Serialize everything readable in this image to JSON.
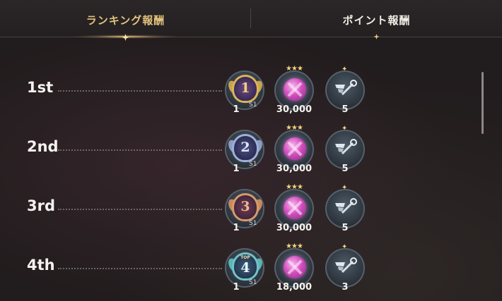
{
  "tabs": [
    {
      "label": "ランキング報酬",
      "active": true
    },
    {
      "label": "ポイント報酬",
      "active": false
    }
  ],
  "rows": [
    {
      "rank": "1st",
      "medal_num": "1",
      "medal_qty": "1",
      "medal_sub": "S1",
      "medal_color": "#d9b45a",
      "gem_qty": "30,000",
      "key_qty": "5"
    },
    {
      "rank": "2nd",
      "medal_num": "2",
      "medal_qty": "1",
      "medal_sub": "S1",
      "medal_color": "#9fb0d8",
      "gem_qty": "30,000",
      "key_qty": "5"
    },
    {
      "rank": "3rd",
      "medal_num": "3",
      "medal_qty": "1",
      "medal_sub": "S1",
      "medal_color": "#d79a6b",
      "gem_qty": "30,000",
      "key_qty": "5"
    },
    {
      "rank": "4th",
      "medal_num": "4",
      "medal_top": "TOP",
      "medal_qty": "1",
      "medal_sub": "S1",
      "medal_color": "#6fc4c8",
      "gem_qty": "18,000",
      "key_qty": "3"
    }
  ],
  "icons": {
    "medal": "rank-medal-icon",
    "gem": "gem-currency-icon",
    "key": "key-item-icon"
  },
  "colors": {
    "active_tab": "#e2c27d",
    "gem": "#d34fbf"
  }
}
